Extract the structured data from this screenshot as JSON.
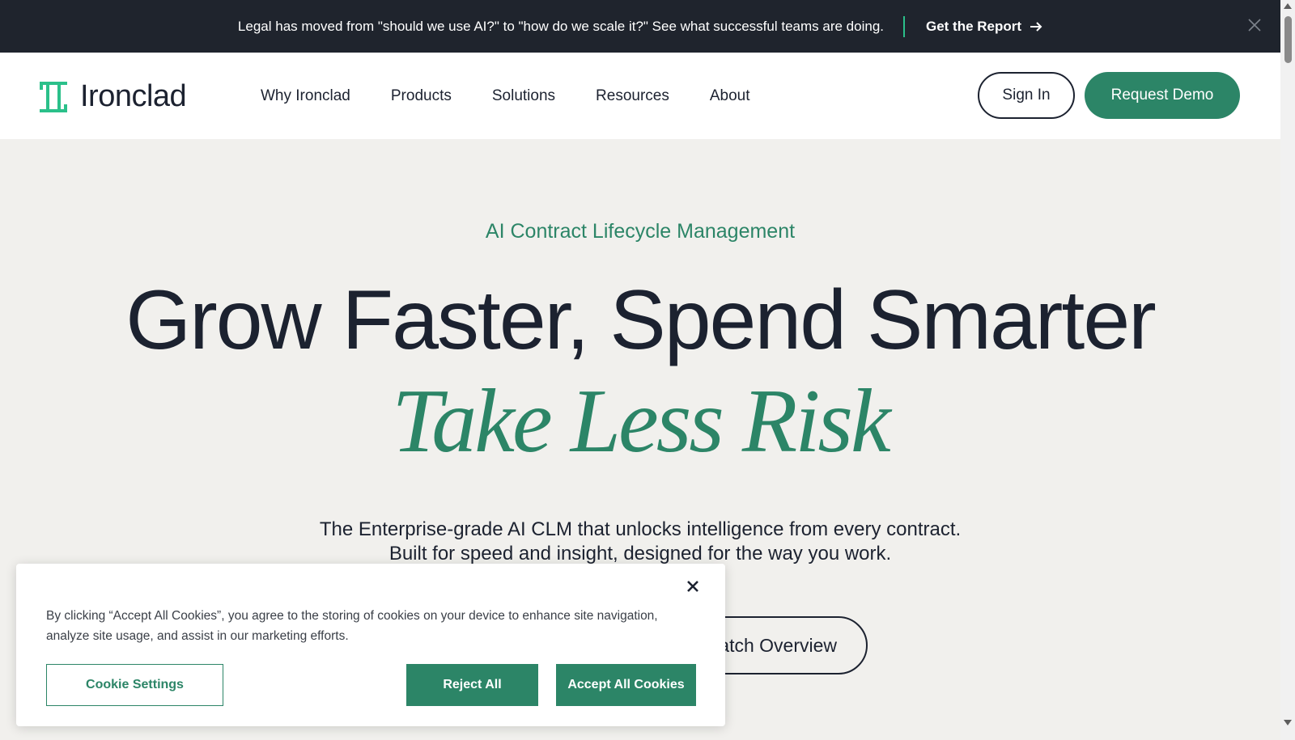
{
  "announcement": {
    "message": "Legal has moved from \"should we use AI?\" to \"how do we scale it?\" See what successful teams are doing.",
    "cta_label": "Get the Report"
  },
  "nav": {
    "brand": "Ironclad",
    "menu": [
      {
        "label": "Why Ironclad"
      },
      {
        "label": "Products"
      },
      {
        "label": "Solutions"
      },
      {
        "label": "Resources"
      },
      {
        "label": "About"
      }
    ],
    "sign_in": "Sign In",
    "request_demo": "Request Demo"
  },
  "hero": {
    "eyebrow": "AI Contract Lifecycle Management",
    "headline": "Grow Faster, Spend Smarter",
    "headline_accent": "Take Less Risk",
    "subtitle_line1": "The Enterprise-grade AI CLM that unlocks intelligence from every contract.",
    "subtitle_line2": "Built for speed and insight, designed for the way you work.",
    "overview_button": "Watch Overview"
  },
  "cookie_banner": {
    "text": "By clicking “Accept All Cookies”, you agree to the storing of cookies on your device to enhance site navigation, analyze site usage, and assist in our marketing efforts.",
    "settings_label": "Cookie Settings",
    "reject_label": "Reject All",
    "accept_label": "Accept All Cookies"
  },
  "colors": {
    "brand_green": "#2c8567",
    "logo_green": "#2bc08a",
    "dark": "#1c2230",
    "announcement_bg": "#1f242d",
    "hero_bg": "#f1f0ed"
  },
  "icons": {
    "logo": "ironclad-logo-icon",
    "announcement_arrow": "arrow-right-icon",
    "announcement_close": "close-icon",
    "cookie_close": "close-icon"
  }
}
